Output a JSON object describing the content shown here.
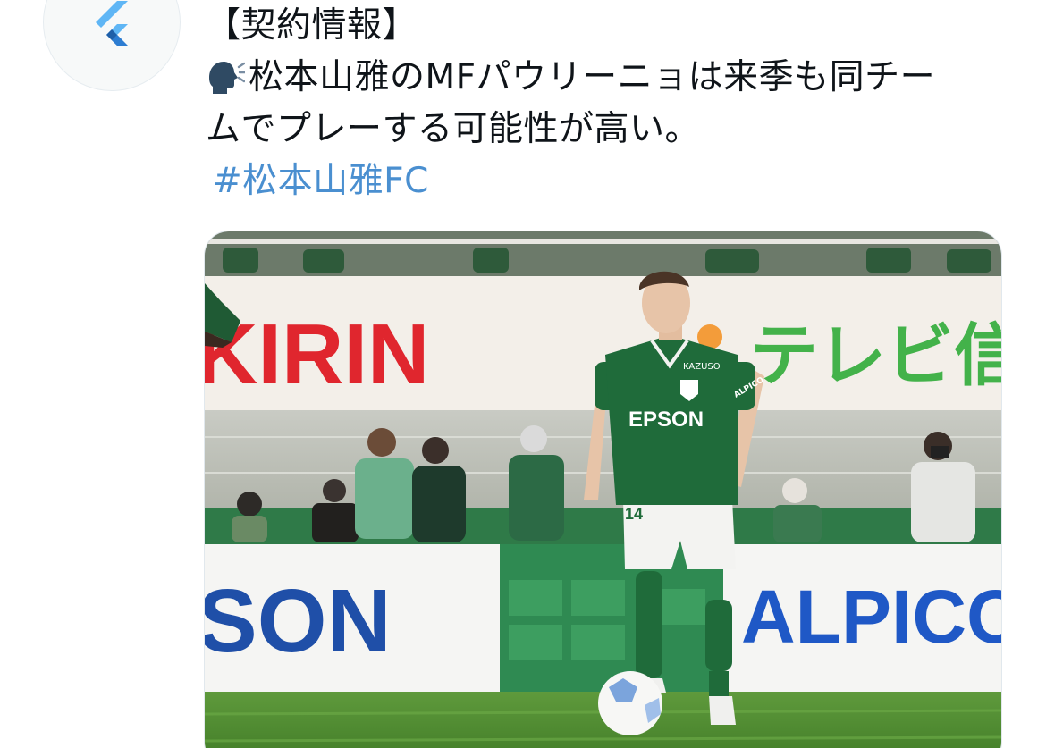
{
  "avatar": {
    "icon": "flutter-logo-icon",
    "accent": "#42a5f5"
  },
  "tweet": {
    "line1": "【契約情報】",
    "emoji": "speaking-head-icon",
    "line2": "松本山雅のMFパウリーニョは来季も同チー",
    "line3": "ムでプレーする可能性が高い。",
    "hashtag": "#松本山雅FC"
  },
  "photo": {
    "banner_left": "KIRIN",
    "banner_right": "テレビ信",
    "jersey_sponsor": "EPSON",
    "jersey_chest": "KAZUSO",
    "jersey_sleeve": "ALPICO",
    "shorts_number": "14",
    "ad_board_left": "SON",
    "ad_board_right": "ALPICO",
    "grass_color": "#4f8a2f",
    "kit_color": "#1f6b3a"
  }
}
